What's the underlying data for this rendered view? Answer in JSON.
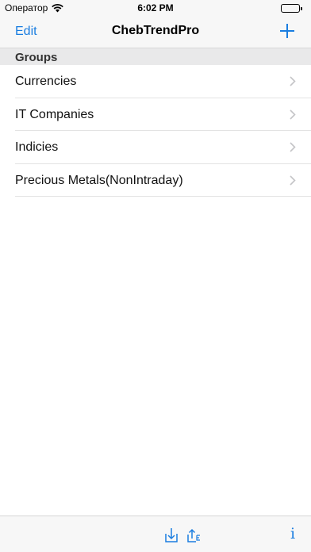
{
  "status_bar": {
    "carrier": "Оператор",
    "time": "6:02 PM"
  },
  "nav": {
    "edit_label": "Edit",
    "title": "ChebTrendPro",
    "add_icon": "plus-icon"
  },
  "section": {
    "header": "Groups"
  },
  "groups": [
    {
      "label": "Currencies"
    },
    {
      "label": "IT Companies"
    },
    {
      "label": "Indicies"
    },
    {
      "label": "Precious Metals(NonIntraday)"
    }
  ],
  "toolbar": {
    "import_icon": "download-icon",
    "export_icon": "export-icon",
    "info_label": "i"
  },
  "colors": {
    "accent": "#1a7de0",
    "bar_background": "#f7f7f7",
    "section_background": "#e9e9ea"
  }
}
